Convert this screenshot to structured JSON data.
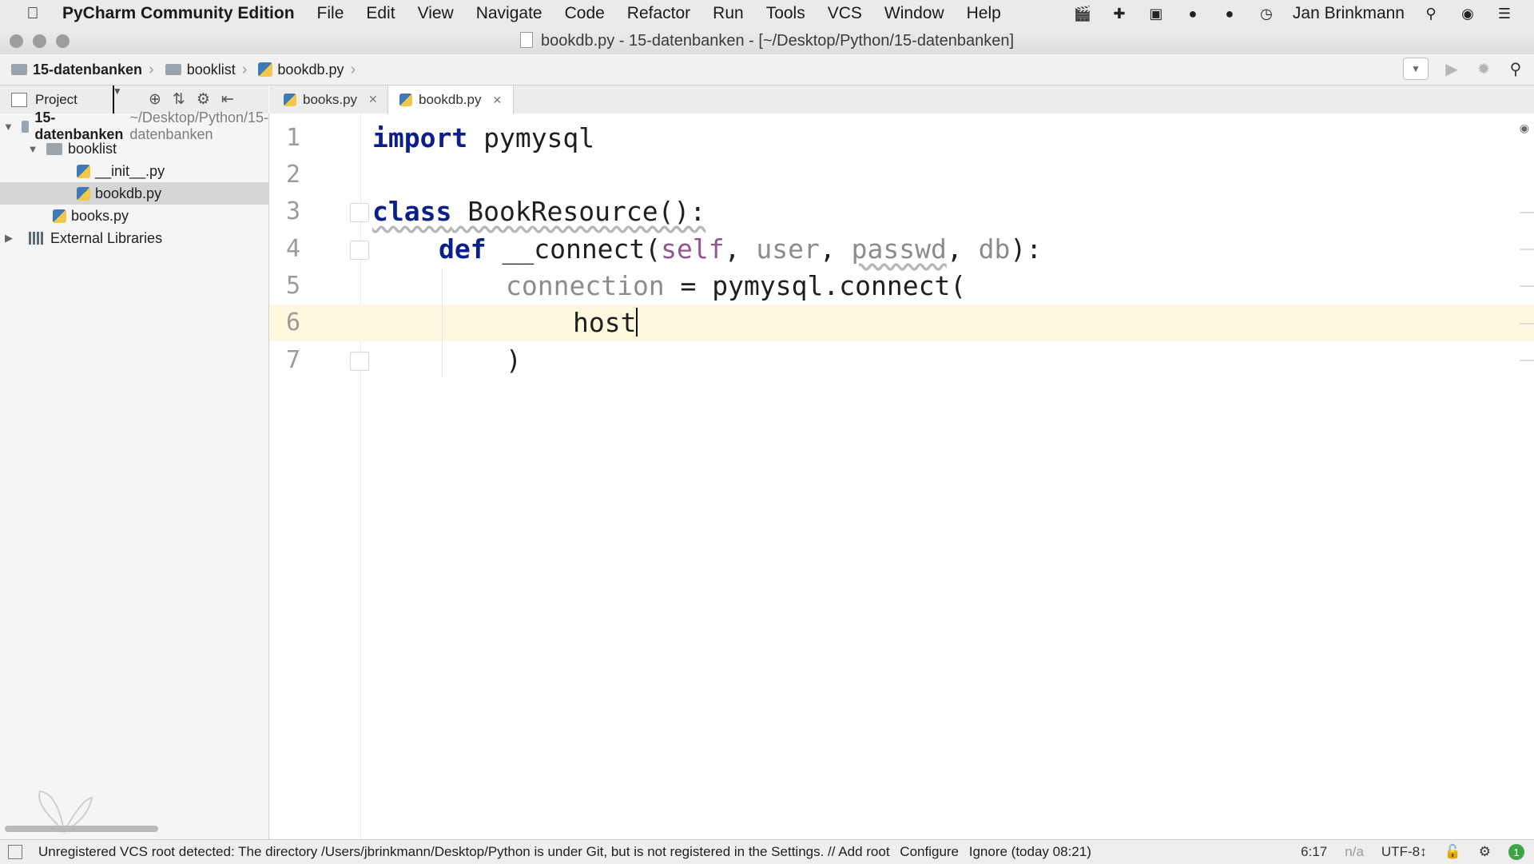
{
  "menubar": {
    "app_name": "PyCharm Community Edition",
    "items": [
      "File",
      "Edit",
      "View",
      "Navigate",
      "Code",
      "Refactor",
      "Run",
      "Tools",
      "VCS",
      "Window",
      "Help"
    ],
    "user": "Jan Brinkmann"
  },
  "window": {
    "title": "bookdb.py - 15-datenbanken - [~/Desktop/Python/15-datenbanken]"
  },
  "breadcrumb": [
    "15-datenbanken",
    "booklist",
    "bookdb.py"
  ],
  "project_panel": {
    "label": "Project",
    "tree": {
      "root": "15-datenbanken",
      "root_hint": "~/Desktop/Python/15-datenbanken",
      "folder": "booklist",
      "file_init": "__init__.py",
      "file_bookdb": "bookdb.py",
      "file_books": "books.py",
      "external": "External Libraries"
    }
  },
  "tabs": [
    "books.py",
    "bookdb.py"
  ],
  "editor": {
    "line_numbers": [
      "1",
      "2",
      "3",
      "4",
      "5",
      "6",
      "7"
    ],
    "tokens": {
      "l1_kw": "import",
      "l1_rest": " pymysql",
      "l3_kw": "class",
      "l3_rest": " BookResource():",
      "l4_kw": "def",
      "l4_name": " __connect(",
      "l4_self": "self",
      "l4_c1": ", ",
      "l4_user": "user",
      "l4_c2": ", ",
      "l4_passwd": "passwd",
      "l4_c3": ", ",
      "l4_db": "db",
      "l4_end": "):",
      "l5_var": "connection",
      "l5_rest": " = pymysql.connect(",
      "l6_text": "host",
      "l7_text": ")"
    }
  },
  "statusbar": {
    "message": "Unregistered VCS root detected: The directory /Users/jbrinkmann/Desktop/Python is under Git, but is not registered in the Settings. // Add root",
    "configure": "Configure",
    "ignore": "Ignore (today 08:21)",
    "position": "6:17",
    "na": "n/a",
    "encoding": "UTF-8↕",
    "events": "1"
  }
}
